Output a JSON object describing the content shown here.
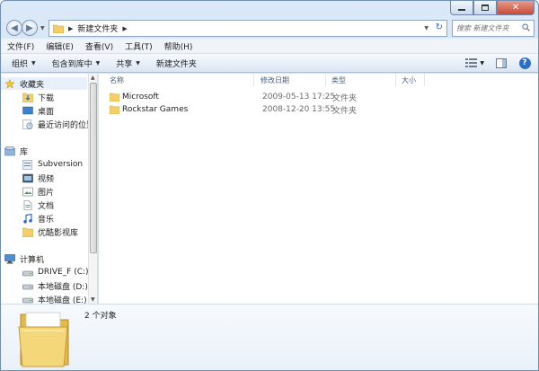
{
  "window": {
    "caption": {
      "minimize": "–",
      "maximize": "□",
      "close": "✕"
    }
  },
  "address": {
    "crumbs": [
      "新建文件夹"
    ],
    "search_placeholder": "搜索 新建文件夹"
  },
  "menu": [
    "文件(F)",
    "编辑(E)",
    "查看(V)",
    "工具(T)",
    "帮助(H)"
  ],
  "toolbar": {
    "organize": "组织",
    "include": "包含到库中",
    "share": "共享",
    "new_folder": "新建文件夹"
  },
  "nav": {
    "favorites": "收藏夹",
    "downloads": "下载",
    "desktop": "桌面",
    "recent": "最近访问的位置",
    "libraries": "库",
    "subversion": "Subversion",
    "videos": "视频",
    "pictures": "图片",
    "documents": "文档",
    "music": "音乐",
    "youku": "优酷影视库",
    "computer": "计算机",
    "drive_f": "DRIVE_F (C:)",
    "drive_d": "本地磁盘 (D:)",
    "drive_e": "本地磁盘 (E:)"
  },
  "columns": {
    "name": "名称",
    "date": "修改日期",
    "type": "类型",
    "size": "大小"
  },
  "files": [
    {
      "name": "Microsoft",
      "date": "2009-05-13 17:25",
      "type": "文件夹"
    },
    {
      "name": "Rockstar Games",
      "date": "2008-12-20 13:55",
      "type": "文件夹"
    }
  ],
  "details": {
    "count": "2 个对象"
  },
  "colors": {
    "accent": "#2f6fc1",
    "folder": "#f2cf6b"
  }
}
